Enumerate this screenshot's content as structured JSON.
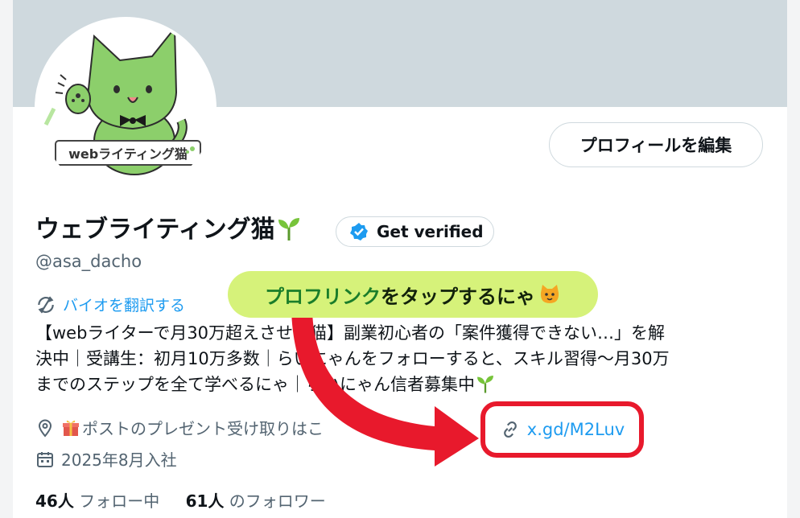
{
  "profile": {
    "edit_button": "プロフィールを編集",
    "display_name": "ウェブライティング猫",
    "verified_label": "Get verified",
    "handle": "@asa_dacho",
    "translate_label": "バイオを翻訳する",
    "bio_lines": [
      "【webライターで月30万超えさせる猫】副業初心者の「案件獲得できない…」を解",
      "決中｜受講生：初月10万多数｜らいにゃんをフォローすると、スキル習得〜月30万",
      "までのステップを全て学べるにゃ｜らいにゃん信者募集中"
    ],
    "location_text": "ポストのプレゼント受け取りはこ",
    "location_arrow": "→",
    "link_text": "x.gd/M2Luv",
    "joined_text": "2025年8月入社",
    "following_count": "46人",
    "following_label": "フォロー中",
    "followers_count": "61人",
    "followers_label": "のフォロワー"
  },
  "avatar": {
    "label": "webライティング猫"
  },
  "callout": {
    "text_green": "プロフリンク",
    "text_dark": "をタップするにゃ"
  },
  "colors": {
    "accent": "#1d9bf0",
    "banner": "#cfd9de",
    "highlight_red": "#e8192c",
    "callout_bg": "#d6f27a",
    "cat_green": "#8ccf6b"
  },
  "icons": [
    "sprout-icon",
    "verified-badge-icon",
    "translate-icon",
    "location-icon",
    "gift-icon",
    "link-icon",
    "calendar-icon",
    "cat-face-icon",
    "pointer-arrow"
  ]
}
